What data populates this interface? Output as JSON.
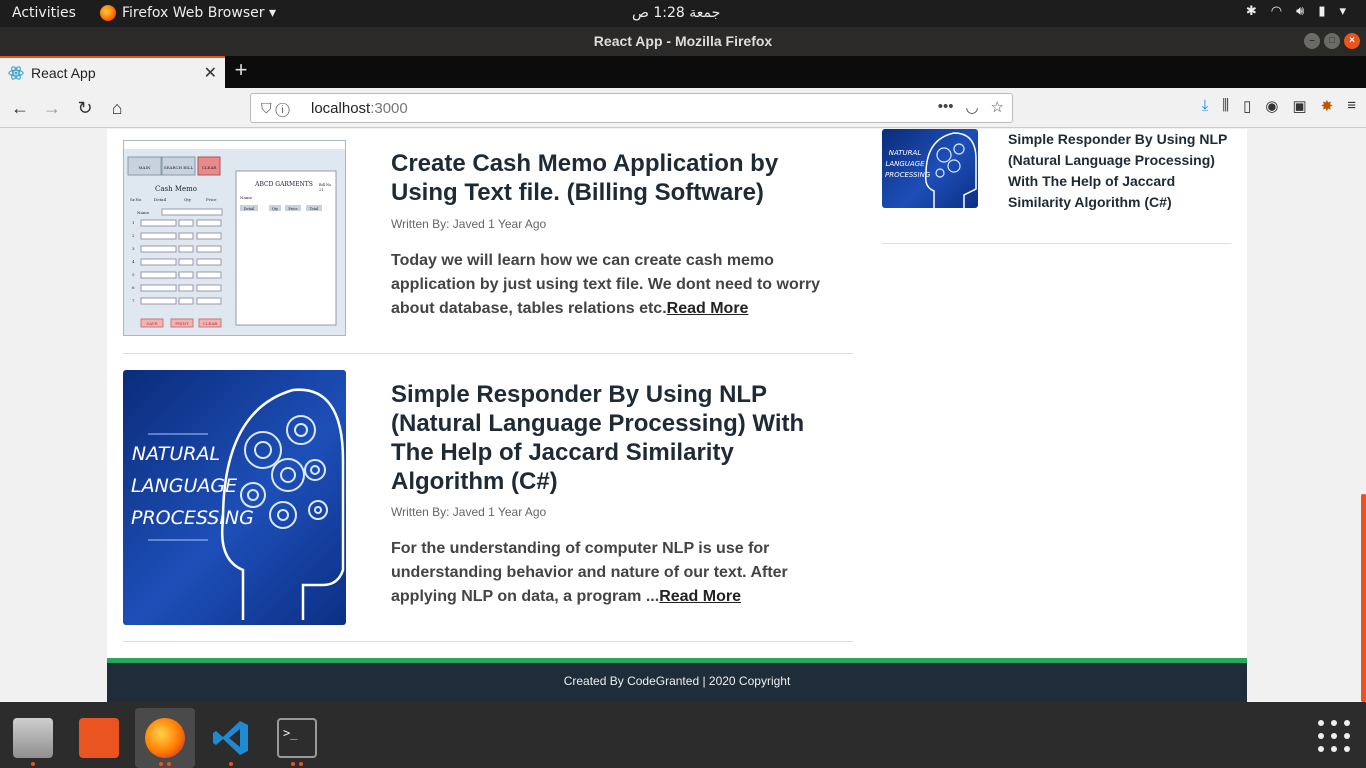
{
  "topbar": {
    "activities": "Activities",
    "app_menu": "Firefox Web Browser ▾",
    "clock": "جمعة  1:28 ص"
  },
  "window": {
    "title": "React App - Mozilla Firefox"
  },
  "tabs": [
    {
      "label": "React App",
      "icon": "react-icon"
    }
  ],
  "navbar": {
    "url_host": "localhost",
    "url_port": ":3000"
  },
  "posts": [
    {
      "title": "Create Cash Memo Application by Using Text file. (Billing Software)",
      "meta": "Written By: Javed 1 Year Ago",
      "excerpt": "Today we will learn how we can create cash memo application by just using text file. We dont need to worry about database, tables relations etc.",
      "read_more": "Read More",
      "thumbnail": "cash-memo-screenshot",
      "thumb_text": {
        "btn_main": "MAIN",
        "btn_search": "SEARCH BILL",
        "btn_clear": "CLEAR",
        "heading": "Cash Memo",
        "col_srno": "Sr.No",
        "col_detail": "Detail",
        "col_qty": "Qty",
        "col_price": "Price",
        "name_label": "Name",
        "rows": [
          "1",
          "2",
          "3",
          "4",
          "5",
          "6",
          "7"
        ],
        "btn_save": "SAVE",
        "btn_print": "PRINT",
        "btn_clear2": "CLEAR",
        "shop": "ABCD GARMENTS",
        "bill_no": "Bill No",
        "bill_num": "21",
        "receipt_name": "Name",
        "receipt_cols": [
          "Detail",
          "Qty",
          "Price",
          "Total"
        ]
      }
    },
    {
      "title": "Simple Responder By Using NLP (Natural Language Processing) With The Help of Jaccard Similarity Algorithm (C#)",
      "meta": "Written By: Javed 1 Year Ago",
      "excerpt": "For the understanding of computer NLP is use for understanding behavior and nature of our text. After applying NLP on data, a program ...",
      "read_more": "Read More",
      "thumbnail": "nlp-head-gears",
      "thumb_text": "NATURAL LANGUAGE PROCESSING"
    }
  ],
  "sidebar": {
    "item_title": "Simple Responder By Using NLP (Natural Language Processing) With The Help of Jaccard Similarity Algorithm (C#)",
    "thumb_text": "NATURAL LANGUAGE PROCESSING"
  },
  "footer": {
    "text": "Created By CodeGranted | 2020 Copyright"
  },
  "dock": [
    "files-icon",
    "software-center-icon",
    "firefox-icon",
    "vscode-icon",
    "terminal-icon"
  ],
  "colors": {
    "ubuntu_orange": "#e95420",
    "footer_bg": "#1f2d3a",
    "footer_accent": "#27a85a",
    "heading": "#1e2a36"
  }
}
